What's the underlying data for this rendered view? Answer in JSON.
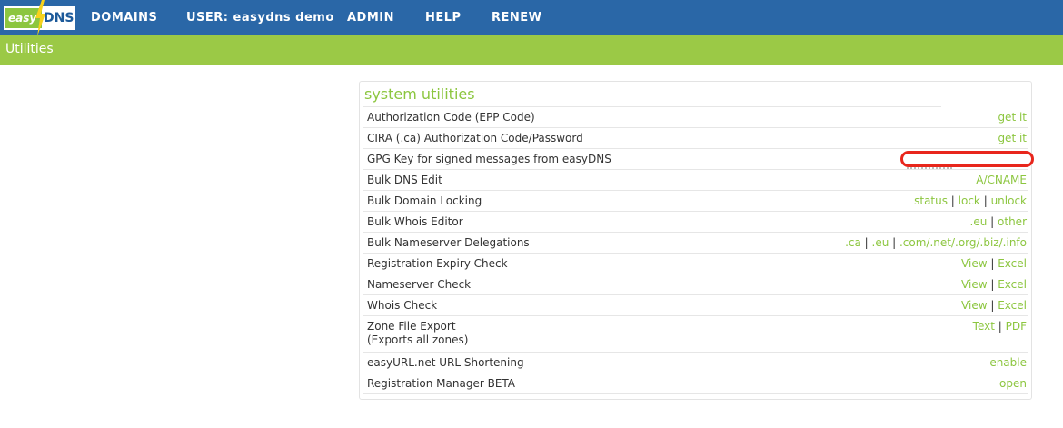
{
  "brand": {
    "logo_left": "easy",
    "logo_right": "DNS",
    "accent": "#8cc63f",
    "nav_bg": "#2a67a7"
  },
  "nav": [
    {
      "label": "DOMAINS"
    },
    {
      "label": "USER: easydns demo"
    },
    {
      "label": "ADMIN"
    },
    {
      "label": "HELP"
    },
    {
      "label": "RENEW"
    }
  ],
  "subheader": {
    "title": "Utilities"
  },
  "panel": {
    "title": "system utilities",
    "rows": [
      {
        "label": "Authorization Code (EPP Code)",
        "actions": [
          "get it"
        ]
      },
      {
        "label": "CIRA (.ca) Authorization Code/Password",
        "actions": [
          "get it"
        ]
      },
      {
        "label": "GPG Key for signed messages from easyDNS",
        "actions": []
      },
      {
        "label": "Bulk DNS Edit",
        "actions": [
          "A/CNAME"
        ]
      },
      {
        "label": "Bulk Domain Locking",
        "actions": [
          "status",
          "lock",
          "unlock"
        ]
      },
      {
        "label": "Bulk Whois Editor",
        "actions": [
          ".eu",
          "other"
        ]
      },
      {
        "label": "Bulk Nameserver Delegations",
        "actions": [
          ".ca",
          ".eu",
          ".com/.net/.org/.biz/.info"
        ]
      },
      {
        "label": "Registration Expiry Check",
        "actions": [
          "View",
          "Excel"
        ]
      },
      {
        "label": "Nameserver Check",
        "actions": [
          "View",
          "Excel"
        ]
      },
      {
        "label": "Whois Check",
        "actions": [
          "View",
          "Excel"
        ]
      },
      {
        "label": "Zone File Export",
        "sublabel": "(Exports all zones)",
        "actions": [
          "Text",
          "PDF"
        ]
      },
      {
        "label": "easyURL.net URL Shortening",
        "actions": [
          "enable"
        ]
      },
      {
        "label": "Registration Manager BETA",
        "actions": [
          "open"
        ]
      }
    ]
  }
}
